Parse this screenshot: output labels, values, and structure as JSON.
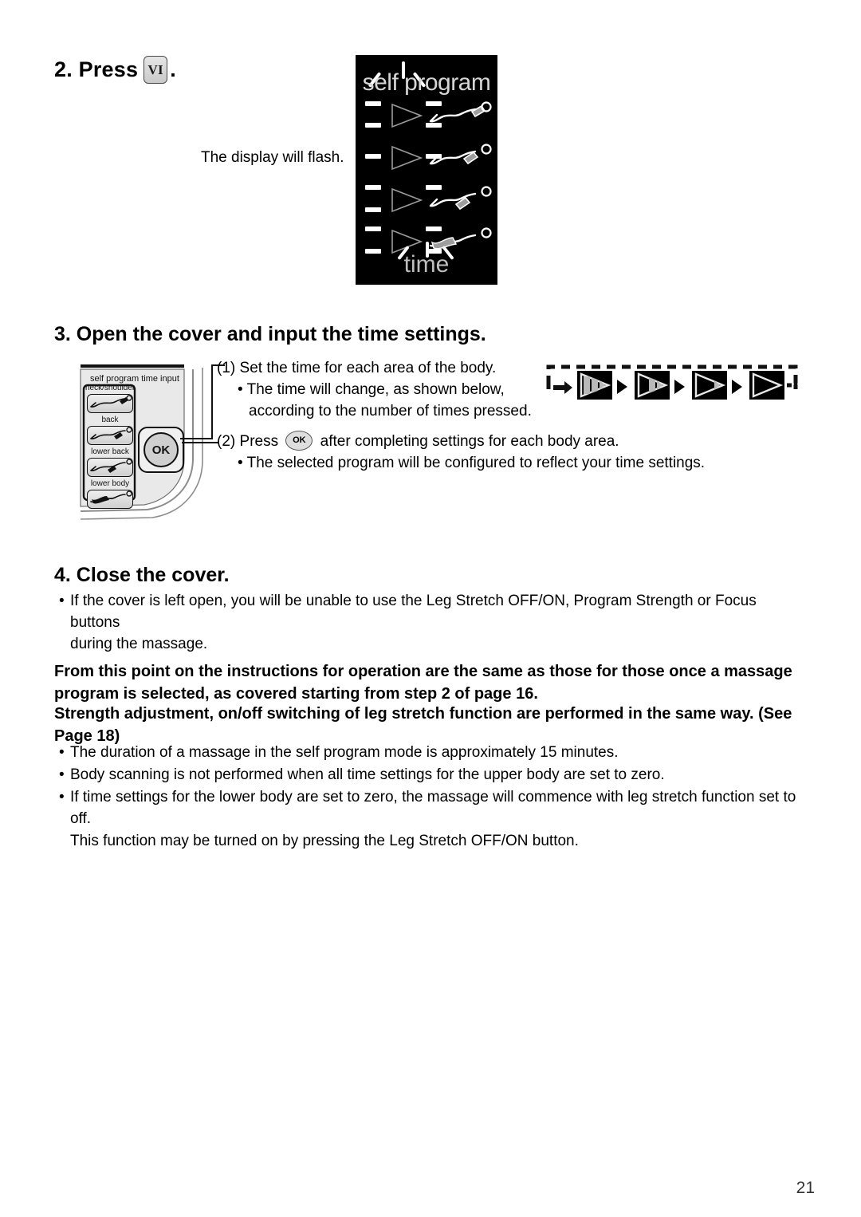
{
  "page": {
    "number": "21"
  },
  "step2": {
    "prefix": "2. Press",
    "button_label": "VI",
    "suffix": ".",
    "note": "The display will flash."
  },
  "display_panel": {
    "title": "self program",
    "time_label": "time",
    "rows": [
      {
        "area": "neck/shoulder",
        "highlight": "head"
      },
      {
        "area": "back",
        "highlight": "upper-back"
      },
      {
        "area": "lower back",
        "highlight": "lower-back"
      },
      {
        "area": "lower body",
        "highlight": "legs"
      }
    ]
  },
  "step3": {
    "heading": "3. Open the cover and input the time settings.",
    "item1": {
      "number": "(1)",
      "text": "Set the time for each area of the body.",
      "bullet": "• The time will change, as shown below,",
      "bullet_cont": "according to the number of times pressed."
    },
    "item2": {
      "number": "(2)",
      "press": "Press",
      "ok_label": "OK",
      "text_after": "after completing settings for each body area.",
      "bullet": "• The selected program will be configured to reflect your time settings."
    },
    "control_panel": {
      "label": "self program time input",
      "buttons": [
        "neck/shoulder",
        "back",
        "lower back",
        "lower body"
      ],
      "ok_label": "OK"
    },
    "cycle_diagram": {
      "states": [
        3,
        2,
        1,
        0
      ],
      "description": "time level cycle"
    }
  },
  "step4": {
    "heading": "4. Close the cover.",
    "bullet": "•",
    "note_line1": "If the cover is left open, you will be unable to use the Leg Stretch OFF/ON, Program Strength or Focus buttons",
    "note_line2": "during the massage."
  },
  "bold_notes": {
    "para1": "From this point on the instructions for operation are the same as those for those once a massage program is selected, as covered starting from step 2 of page 16.",
    "para2": "Strength adjustment, on/off switching of leg stretch function are performed in the same way. (See Page 18)"
  },
  "final_notes": {
    "bullet": "•",
    "note1": "The duration of a massage in the self program mode is approximately 15 minutes.",
    "note2": "Body scanning is not performed when all time settings for the upper body are set to zero.",
    "note3": "If time settings for the lower body are set to zero, the massage will commence with leg stretch function set to off.",
    "note3_cont": "This function may be turned on by pressing the Leg Stretch OFF/ON button."
  },
  "colors": {
    "lcd_background": "#000000",
    "lcd_text": "#d6d6d6",
    "ink": "#000000"
  }
}
